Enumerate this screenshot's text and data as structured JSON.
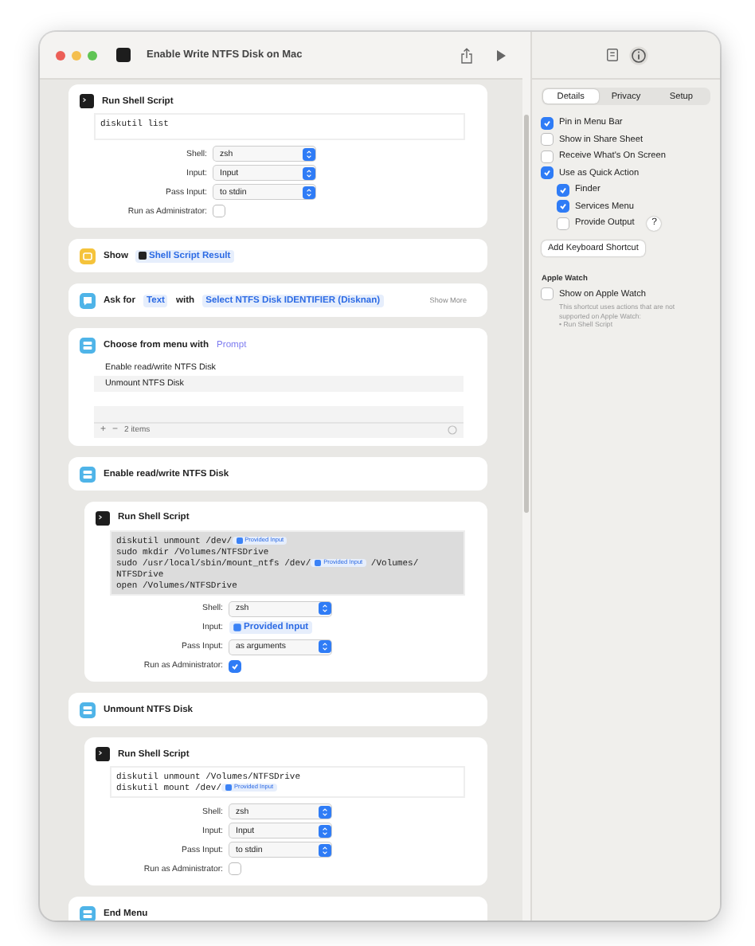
{
  "window": {
    "title": "Enable Write NTFS Disk on Mac"
  },
  "actions": [
    {
      "kind": "shell",
      "title": "Run Shell Script",
      "script": {
        "highlighted": false,
        "lines": [
          [
            {
              "kind": "text",
              "text": "diskutil list"
            }
          ]
        ]
      },
      "fields": [
        {
          "label": "Shell:",
          "kind": "select",
          "value": "zsh"
        },
        {
          "label": "Input:",
          "kind": "select",
          "value": "Input"
        },
        {
          "label": "Pass Input:",
          "kind": "select",
          "value": "to stdin"
        },
        {
          "label": "Run as Administrator:",
          "kind": "checkbox",
          "checked": false
        }
      ]
    },
    {
      "kind": "show",
      "title": "Show",
      "token": "Shell Script Result"
    },
    {
      "kind": "ask",
      "title": "Ask for",
      "type": "Text",
      "joiner": "with",
      "prompt": "Select NTFS Disk IDENTIFIER (Disknan)",
      "more": "Show More"
    },
    {
      "kind": "menu",
      "title": "Choose from menu with",
      "prompt": "Prompt",
      "items": [
        "Enable read/write NTFS Disk",
        "Unmount NTFS Disk"
      ],
      "add": "+",
      "remove": "−",
      "count": "2 items"
    },
    {
      "kind": "case",
      "title": "Enable read/write NTFS Disk",
      "children": [
        {
          "kind": "shell",
          "title": "Run Shell Script",
          "script": {
            "highlighted": true,
            "lines": [
              [
                {
                  "kind": "text",
                  "text": "diskutil unmount /dev/"
                },
                {
                  "kind": "token",
                  "text": "Provided Input"
                }
              ],
              [
                {
                  "kind": "text",
                  "text": "sudo mkdir /Volumes/NTFSDrive"
                }
              ],
              [
                {
                  "kind": "text",
                  "text": "sudo /usr/local/sbin/mount_ntfs /dev/"
                },
                {
                  "kind": "token",
                  "text": "Provided Input"
                },
                {
                  "kind": "text",
                  "text": " /Volumes/"
                }
              ],
              [
                {
                  "kind": "text",
                  "text": "NTFSDrive"
                }
              ],
              [
                {
                  "kind": "text",
                  "text": "open /Volumes/NTFSDrive"
                }
              ]
            ]
          },
          "fields": [
            {
              "label": "Shell:",
              "kind": "select",
              "value": "zsh"
            },
            {
              "label": "Input:",
              "kind": "token",
              "value": "Provided Input"
            },
            {
              "label": "Pass Input:",
              "kind": "select",
              "value": "as arguments"
            },
            {
              "label": "Run as Administrator:",
              "kind": "checkbox",
              "checked": true
            }
          ]
        }
      ]
    },
    {
      "kind": "case",
      "title": "Unmount NTFS Disk",
      "children": [
        {
          "kind": "shell",
          "title": "Run Shell Script",
          "script": {
            "highlighted": false,
            "lines": [
              [
                {
                  "kind": "text",
                  "text": "diskutil unmount /Volumes/NTFSDrive"
                }
              ],
              [
                {
                  "kind": "text",
                  "text": "diskutil mount /dev/"
                },
                {
                  "kind": "token",
                  "text": "Provided Input"
                }
              ]
            ]
          },
          "fields": [
            {
              "label": "Shell:",
              "kind": "select",
              "value": "zsh"
            },
            {
              "label": "Input:",
              "kind": "select",
              "value": "Input"
            },
            {
              "label": "Pass Input:",
              "kind": "select",
              "value": "to stdin"
            },
            {
              "label": "Run as Administrator:",
              "kind": "checkbox",
              "checked": false
            }
          ]
        }
      ]
    },
    {
      "kind": "end",
      "title": "End Menu"
    }
  ],
  "inspector": {
    "tabs": [
      {
        "label": "Details",
        "selected": true
      },
      {
        "label": "Privacy",
        "selected": false
      },
      {
        "label": "Setup",
        "selected": false
      }
    ],
    "options": [
      {
        "label": "Pin in Menu Bar",
        "checked": true
      },
      {
        "label": "Show in Share Sheet",
        "checked": false
      },
      {
        "label": "Receive What's On Screen",
        "checked": false
      },
      {
        "label": "Use as Quick Action",
        "checked": true,
        "children": [
          {
            "label": "Finder",
            "checked": true
          },
          {
            "label": "Services Menu",
            "checked": true
          },
          {
            "label": "Provide Output",
            "checked": false,
            "help": "?"
          }
        ]
      }
    ],
    "button": "Add Keyboard Shortcut",
    "watch": {
      "heading": "Apple Watch",
      "label": "Show on Apple Watch",
      "checked": false,
      "note": "This shortcut uses actions that are not supported on Apple Watch:",
      "note_item": "• Run Shell Script"
    }
  }
}
